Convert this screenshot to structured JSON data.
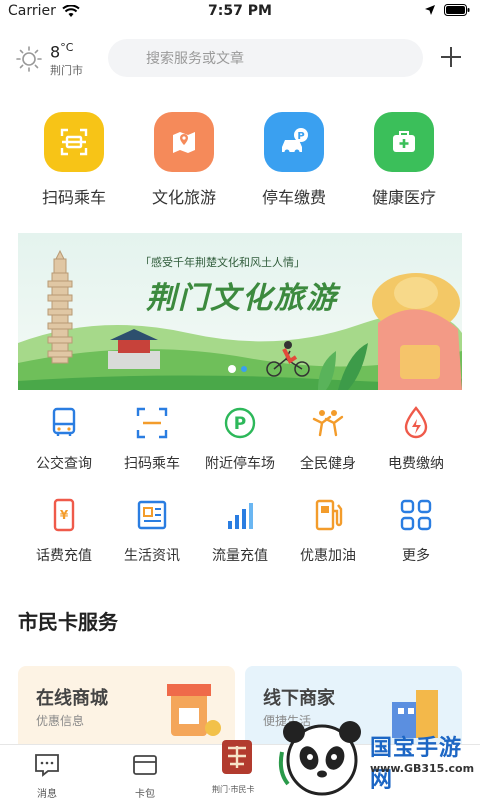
{
  "status": {
    "carrier": "Carrier",
    "time": "7:57 PM"
  },
  "weather": {
    "temp": "8",
    "unit": "°C",
    "city": "荆门市"
  },
  "search": {
    "placeholder": "搜索服务或文章"
  },
  "quick": [
    {
      "label": "扫码乘车",
      "icon": "scan-icon",
      "color": "#f7c417"
    },
    {
      "label": "文化旅游",
      "icon": "map-icon",
      "color": "#f58a5a"
    },
    {
      "label": "停车缴费",
      "icon": "car-parking-icon",
      "color": "#3aa0f0"
    },
    {
      "label": "健康医疗",
      "icon": "medical-kit-icon",
      "color": "#3bbf5a"
    }
  ],
  "banner": {
    "tag": "「感受千年荆楚文化和风土人情」",
    "title": "荆门文化旅游"
  },
  "grid": [
    {
      "label": "公交查询",
      "icon": "bus-icon",
      "color": "#2a7de1"
    },
    {
      "label": "扫码乘车",
      "icon": "scan-icon",
      "color": "#2a7de1"
    },
    {
      "label": "附近停车场",
      "icon": "parking-icon",
      "color": "#2db85a"
    },
    {
      "label": "全民健身",
      "icon": "fitness-icon",
      "color": "#f39c2b"
    },
    {
      "label": "电费缴纳",
      "icon": "electricity-icon",
      "color": "#ef5a4a"
    },
    {
      "label": "话费充值",
      "icon": "phone-bill-icon",
      "color": "#ef5a4a"
    },
    {
      "label": "生活资讯",
      "icon": "news-icon",
      "color": "#2a7de1"
    },
    {
      "label": "流量充值",
      "icon": "data-signal-icon",
      "color": "#2a7de1"
    },
    {
      "label": "优惠加油",
      "icon": "fuel-icon",
      "color": "#f39c2b"
    },
    {
      "label": "更多",
      "icon": "more-grid-icon",
      "color": "#2a7de1"
    }
  ],
  "section": {
    "title": "市民卡服务"
  },
  "cards": [
    {
      "title": "在线商城",
      "subtitle": "优惠信息",
      "bg": "#fdf3e4"
    },
    {
      "title": "线下商家",
      "subtitle": "便捷生活",
      "bg": "#e6f3fb"
    }
  ],
  "tabs": [
    {
      "label": "消息",
      "icon": "message-icon"
    },
    {
      "label": "卡包",
      "icon": "card-wallet-icon"
    }
  ],
  "watermark": {
    "text": "国宝手游网",
    "url": "www.GB315.com",
    "seal": "荆门·市民卡"
  }
}
